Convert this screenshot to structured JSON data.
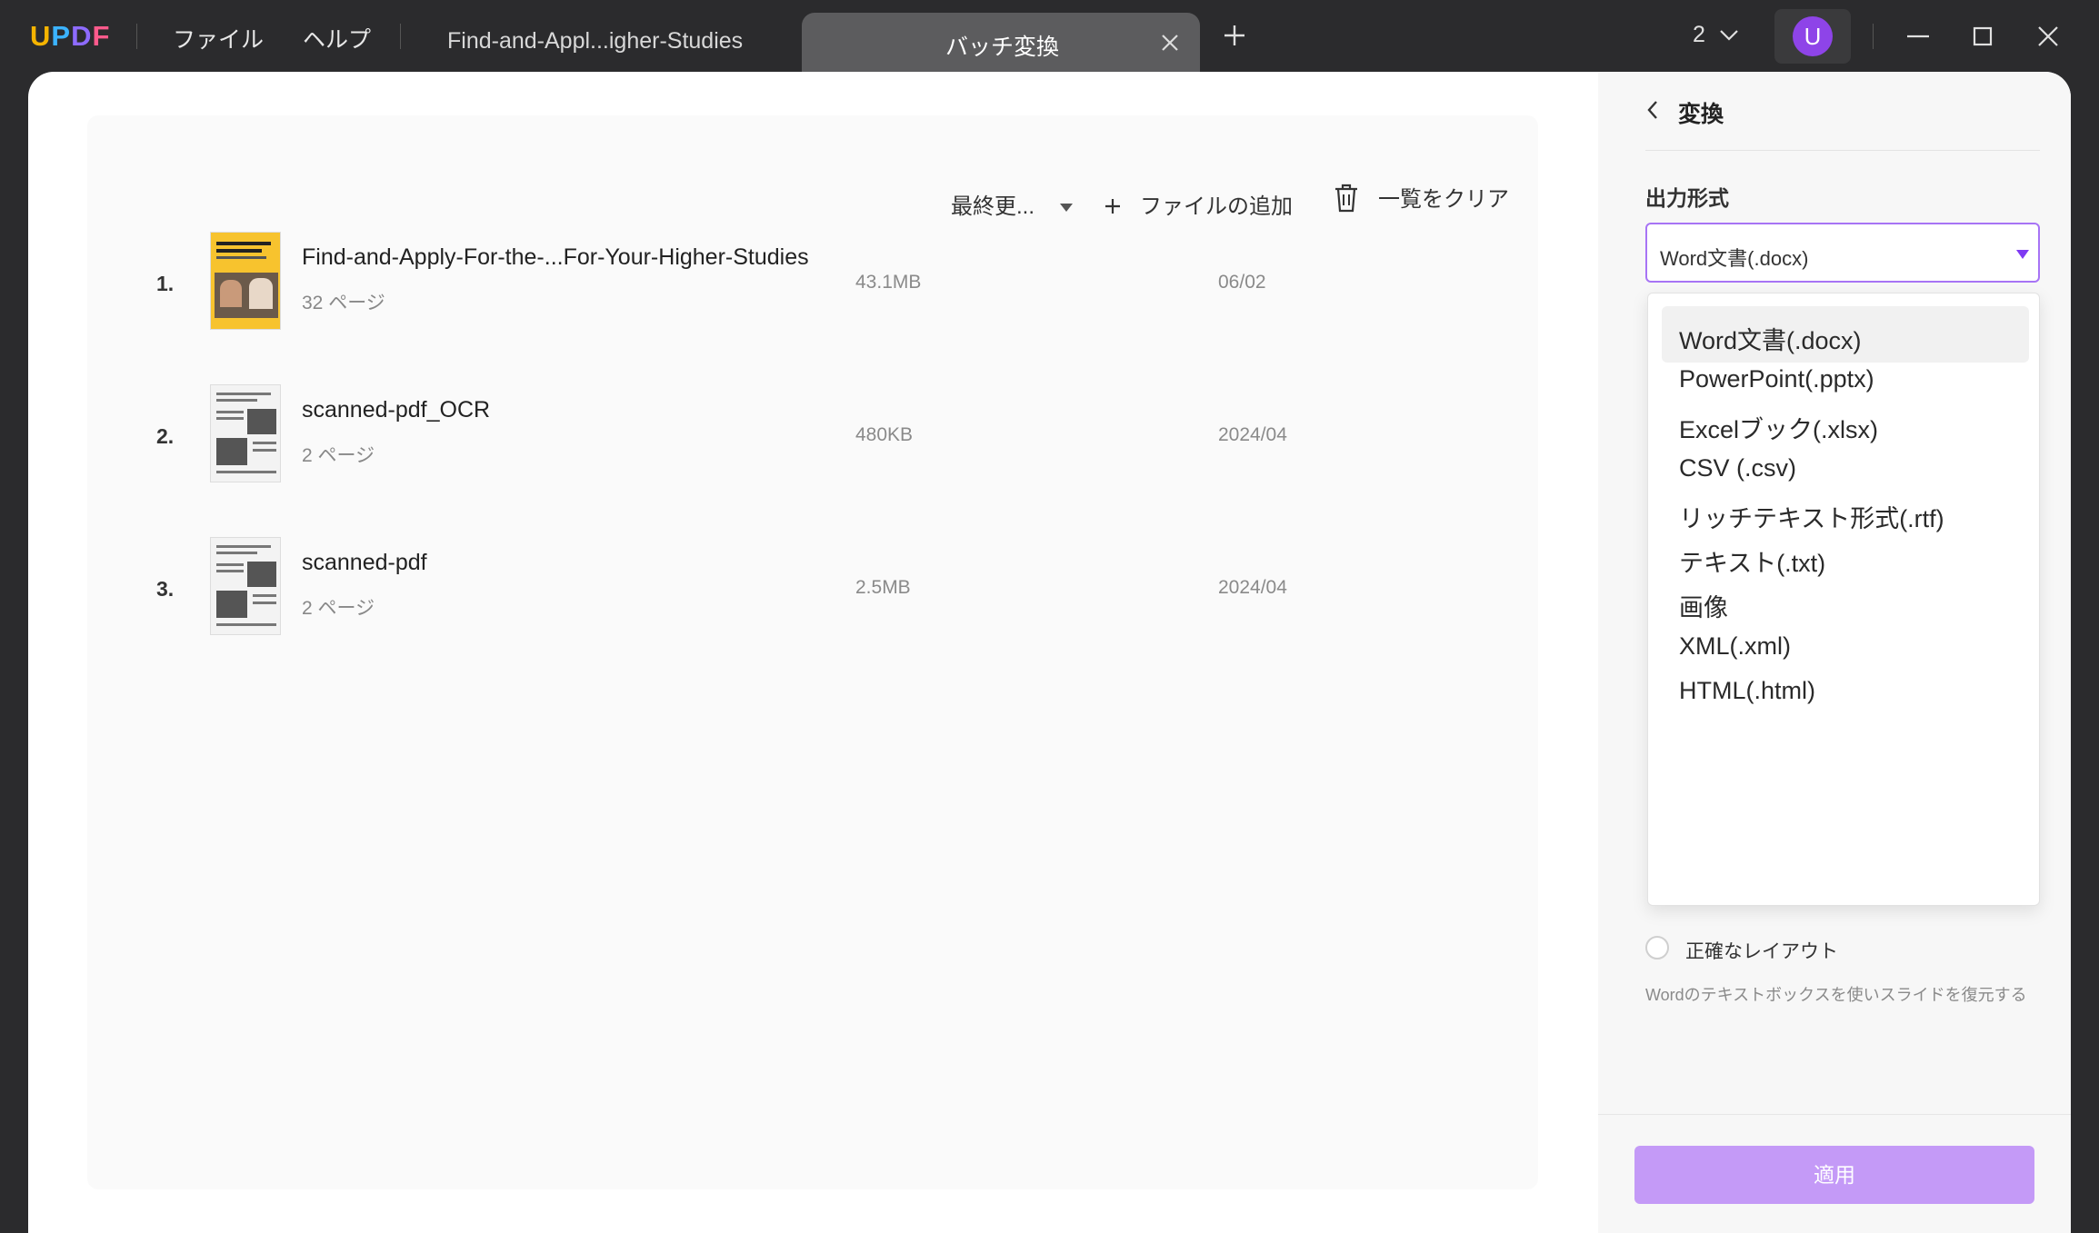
{
  "titlebar": {
    "logo": {
      "u": "U",
      "p": "P",
      "d": "D",
      "f": "F"
    },
    "menu": [
      "ファイル",
      "ヘルプ"
    ],
    "tabs": [
      {
        "label": "Find-and-Appl...igher-Studies",
        "active": false
      },
      {
        "label": "バッチ変換",
        "active": true
      }
    ],
    "window_count": "2",
    "avatar_letter": "U",
    "icons": [
      "chevron-down-icon",
      "minimize-icon",
      "maximize-icon",
      "close-icon",
      "plus-icon"
    ]
  },
  "toolbar": {
    "sort_label": "最終更...",
    "add_files_label": "ファイルの追加",
    "clear_list_label": "一覧をクリア"
  },
  "files": [
    {
      "num": "1.",
      "name": "Find-and-Apply-For-the-...For-Your-Higher-Studies",
      "pages": "32 ページ",
      "size": "43.1MB",
      "date": "06/02"
    },
    {
      "num": "2.",
      "name": "scanned-pdf_OCR",
      "pages": "2 ページ",
      "size": "480KB",
      "date": "2024/04"
    },
    {
      "num": "3.",
      "name": "scanned-pdf",
      "pages": "2 ページ",
      "size": "2.5MB",
      "date": "2024/04"
    }
  ],
  "side": {
    "title": "変換",
    "output_format_label": "出力形式",
    "selected_format": "Word文書(.docx)",
    "options": [
      "Word文書(.docx)",
      "PowerPoint(.pptx)",
      "Excelブック(.xlsx)",
      "CSV (.csv)",
      "リッチテキスト形式(.rtf)",
      "テキスト(.txt)",
      "画像",
      "XML(.xml)",
      "HTML(.html)"
    ],
    "layout_option_label": "正確なレイアウト",
    "layout_hint": "Wordのテキストボックスを使いスライドを復元する",
    "apply_label": "適用"
  },
  "colors": {
    "accent": "#a774f5",
    "apply_button": "#c49af7",
    "avatar": "#8e44e8",
    "titlebar": "#2b2b2d"
  }
}
